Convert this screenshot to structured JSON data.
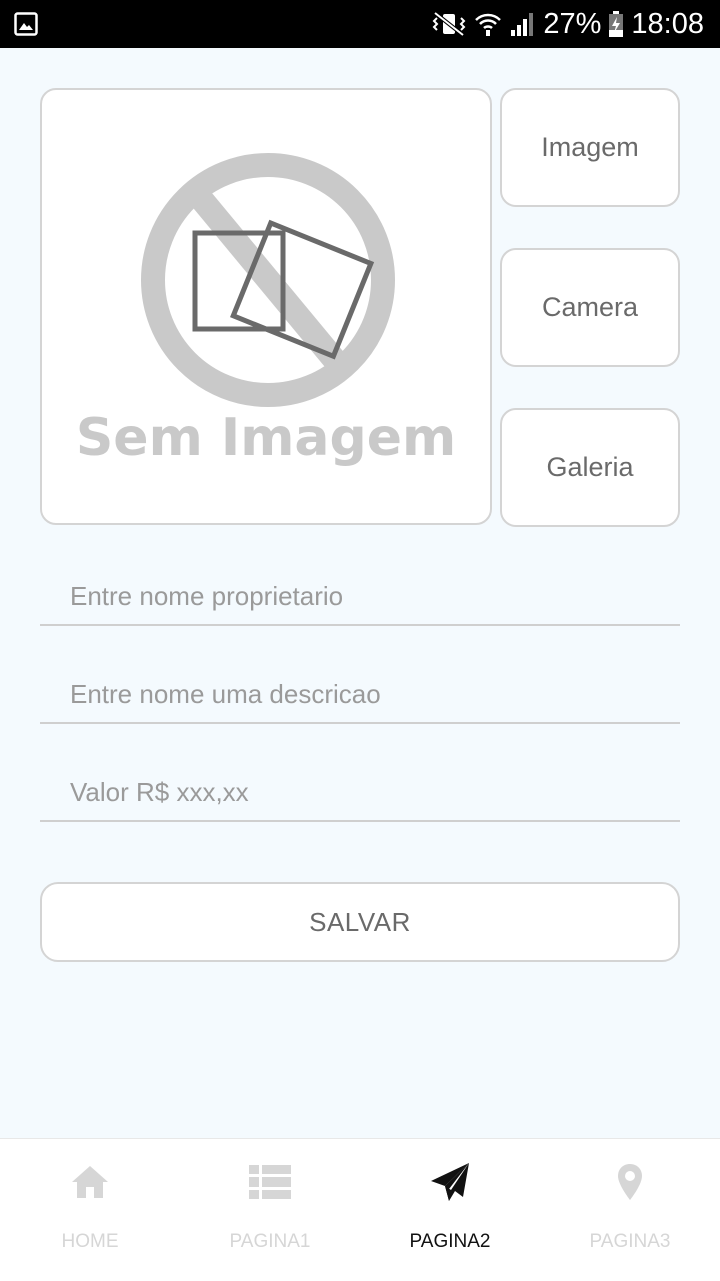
{
  "status_bar": {
    "battery_percent": "27%",
    "time": "18:08"
  },
  "image_panel": {
    "placeholder_text": "Sem Imagem"
  },
  "side_buttons": {
    "imagem": "Imagem",
    "camera": "Camera",
    "galeria": "Galeria"
  },
  "form": {
    "owner": {
      "placeholder": "Entre nome proprietario",
      "value": ""
    },
    "description": {
      "placeholder": "Entre nome uma descricao",
      "value": ""
    },
    "price": {
      "placeholder": "Valor R$ xxx,xx",
      "value": ""
    },
    "save_label": "SALVAR"
  },
  "tabs": [
    {
      "label": "HOME",
      "icon": "home-icon",
      "active": false
    },
    {
      "label": "PAGINA1",
      "icon": "list-icon",
      "active": false
    },
    {
      "label": "PAGINA2",
      "icon": "send-icon",
      "active": true
    },
    {
      "label": "PAGINA3",
      "icon": "location-pin-icon",
      "active": false
    }
  ],
  "colors": {
    "background": "#f4fafe",
    "active_tab": "#111111",
    "inactive_tab": "#d6d6d6"
  }
}
